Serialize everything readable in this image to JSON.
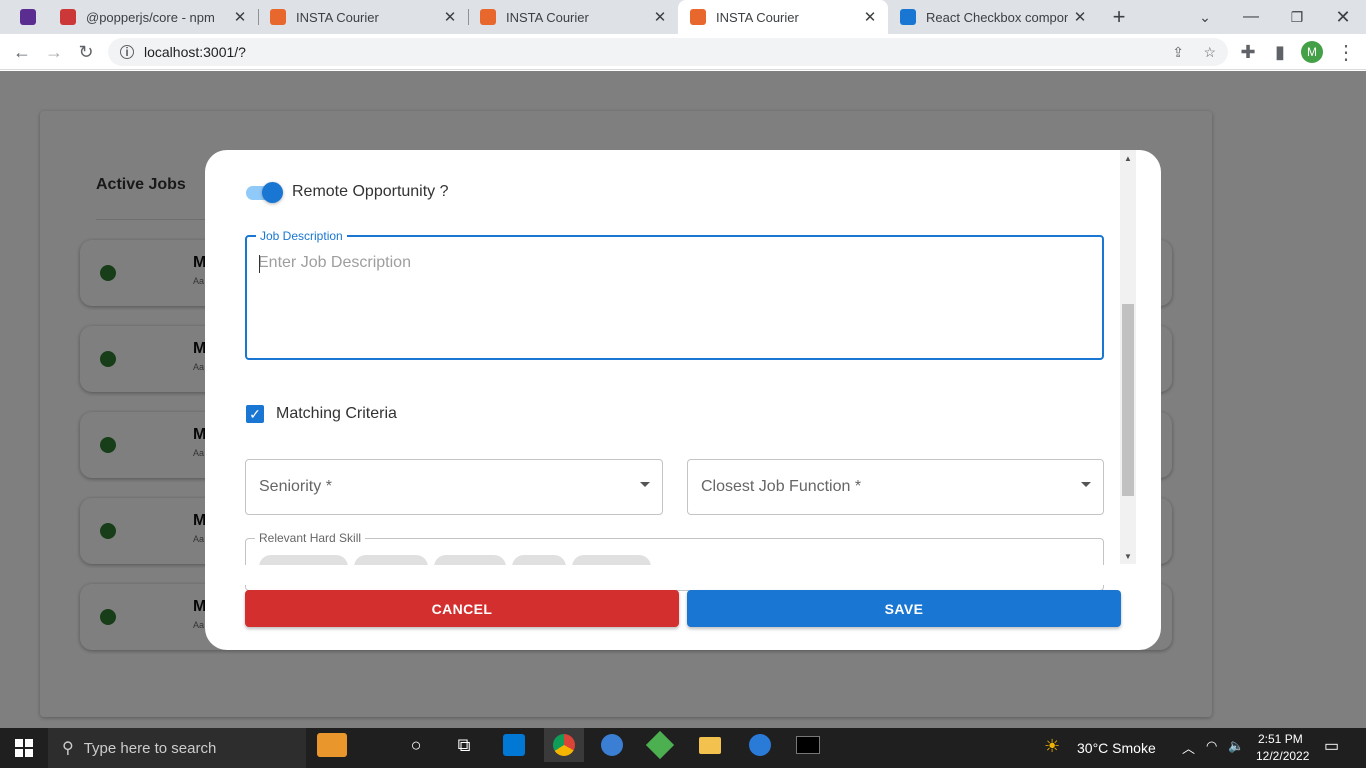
{
  "browser": {
    "tabs": [
      {
        "title": "",
        "color": "#5c2d91"
      },
      {
        "title": "@popperjs/core - npm",
        "color": "#cb3837"
      },
      {
        "title": "INSTA Courier",
        "color": "#e8672d"
      },
      {
        "title": "INSTA Courier",
        "color": "#e8672d"
      },
      {
        "title": "INSTA Courier",
        "color": "#e8672d"
      },
      {
        "title": "React Checkbox componen",
        "color": "#1976d2"
      }
    ],
    "url": "localhost:3001/?",
    "profile_initial": "M"
  },
  "page": {
    "active_jobs_title": "Active Jobs",
    "job_rows": [
      {
        "title": "M",
        "sub": "Aa"
      },
      {
        "title": "M",
        "sub": "Aa"
      },
      {
        "title": "M",
        "sub": "Aa"
      },
      {
        "title": "M",
        "sub": "Aa"
      },
      {
        "title": "M",
        "sub": "Aa"
      }
    ]
  },
  "dialog": {
    "remote_label": "Remote Opportunity ?",
    "remote_on": true,
    "job_description": {
      "label": "Job Description",
      "placeholder": "Enter Job Description",
      "value": ""
    },
    "matching_criteria": {
      "label": "Matching Criteria",
      "checked": true
    },
    "seniority": {
      "label": "Seniority *"
    },
    "job_function": {
      "label": "Closest Job Function *"
    },
    "hard_skill": {
      "label": "Relevant Hard Skill"
    },
    "cancel_label": "CANCEL",
    "save_label": "SAVE",
    "colors": {
      "primary": "#1976d2",
      "danger": "#d32f2f"
    }
  },
  "taskbar": {
    "search_placeholder": "Type here to search",
    "weather": "30°C  Smoke",
    "time": "2:51 PM",
    "date": "12/2/2022"
  }
}
